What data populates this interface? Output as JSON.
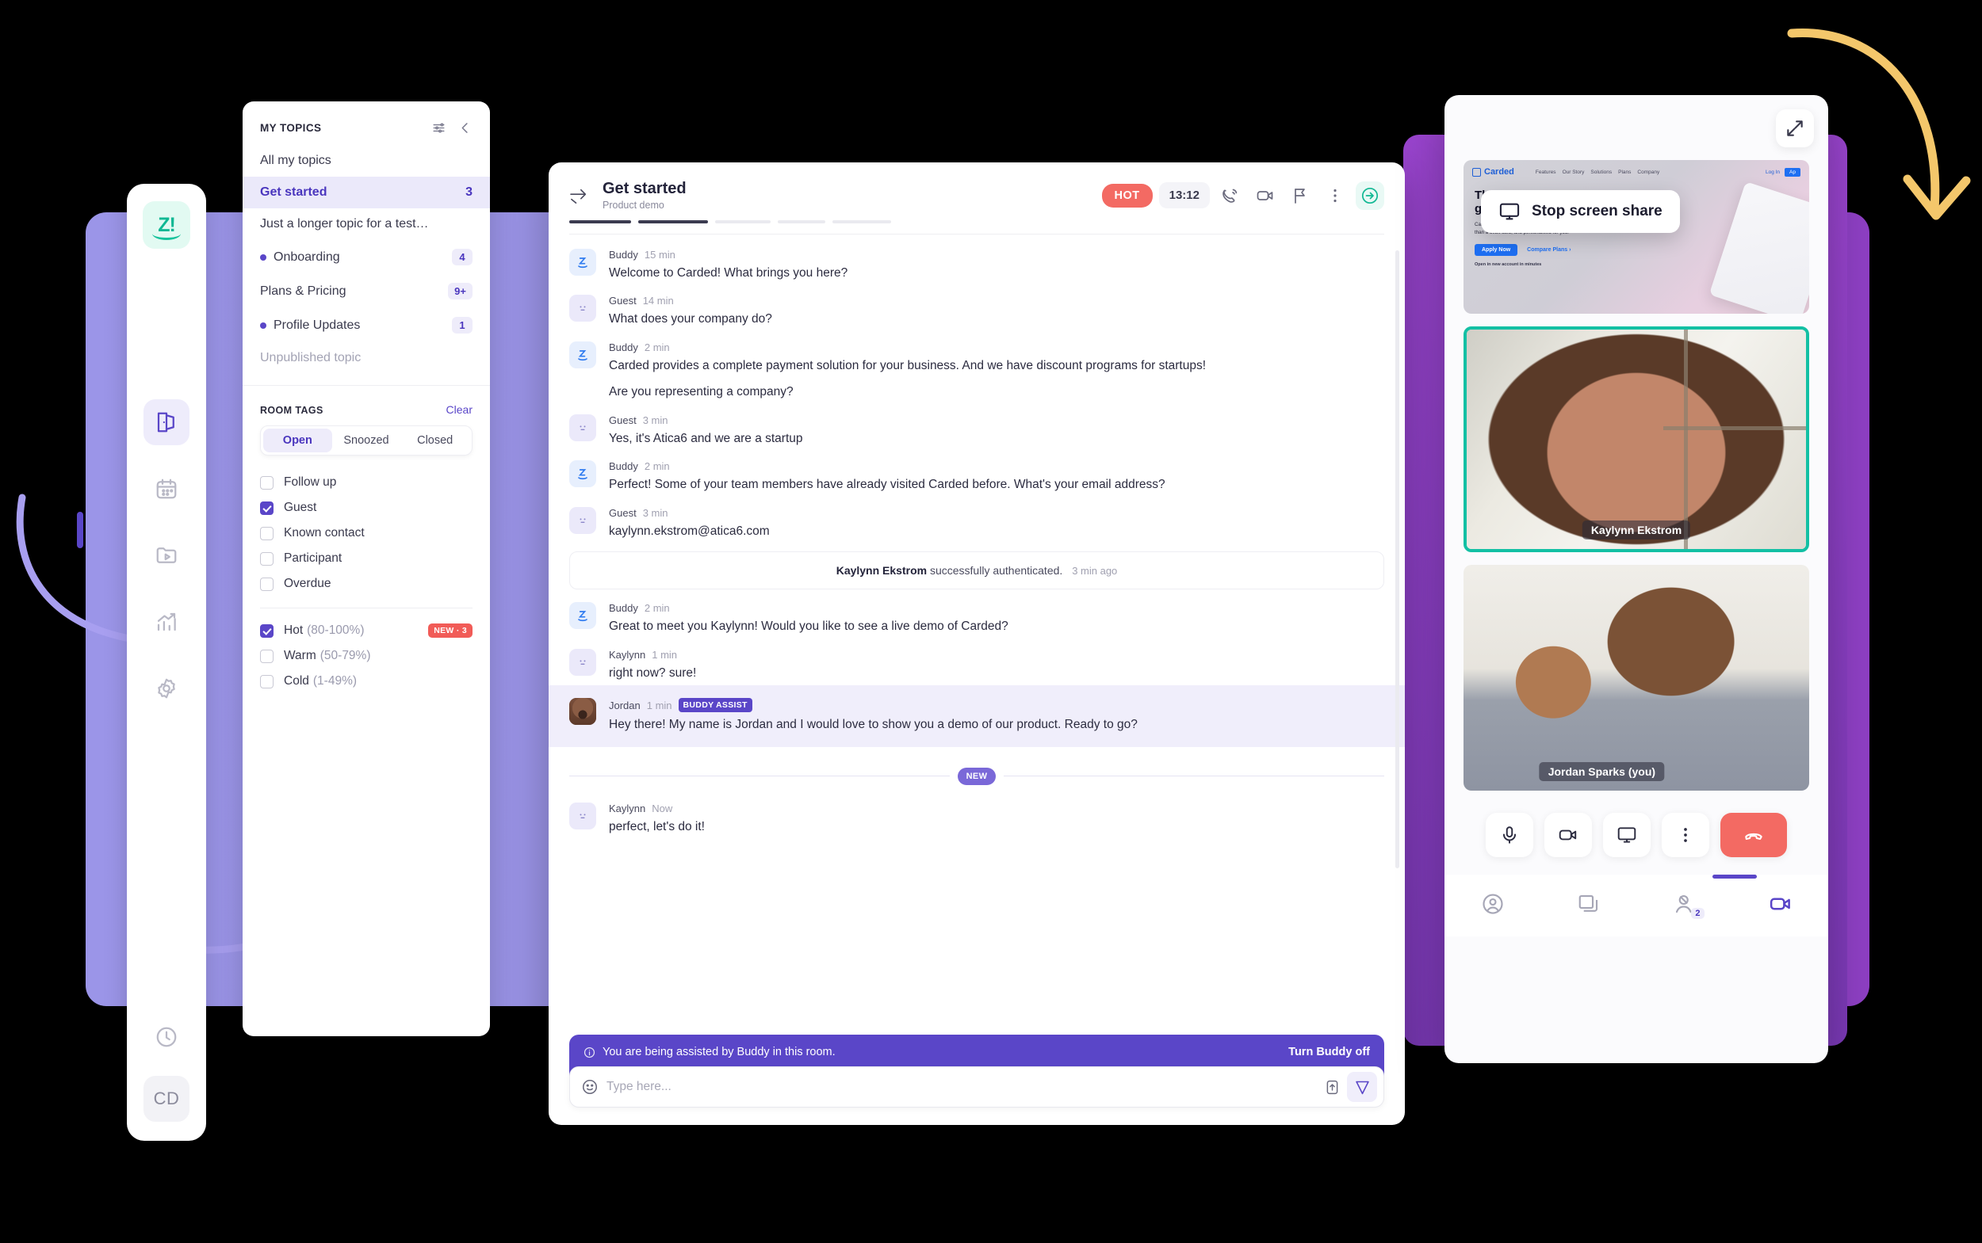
{
  "app": {
    "logo_text": "Z!",
    "user_initials": "CD"
  },
  "rail": {
    "items": [
      {
        "name": "rooms",
        "icon": "door-icon",
        "active": true
      },
      {
        "name": "calendar",
        "icon": "calendar-icon",
        "active": false
      },
      {
        "name": "library",
        "icon": "folder-play-icon",
        "active": false
      },
      {
        "name": "analytics",
        "icon": "bar-chart-icon",
        "active": false
      },
      {
        "name": "settings",
        "icon": "gear-icon",
        "active": false
      },
      {
        "name": "history",
        "icon": "clock-icon",
        "active": false
      }
    ]
  },
  "topics": {
    "header_title": "MY TOPICS",
    "filter_icon": "sliders-icon",
    "collapse_icon": "chevron-left-icon",
    "items": [
      {
        "label": "All my topics",
        "count": "",
        "dot": false,
        "selected": false,
        "muted": false
      },
      {
        "label": "Get started",
        "count": "3",
        "dot": false,
        "selected": true,
        "muted": false
      },
      {
        "label": "Just a longer topic for a test…",
        "count": "",
        "dot": false,
        "selected": false,
        "muted": false
      },
      {
        "label": "Onboarding",
        "count": "4",
        "dot": true,
        "selected": false,
        "muted": false
      },
      {
        "label": "Plans & Pricing",
        "count": "9+",
        "dot": false,
        "selected": false,
        "muted": false
      },
      {
        "label": "Profile Updates",
        "count": "1",
        "dot": true,
        "selected": false,
        "muted": false
      },
      {
        "label": "Unpublished topic",
        "count": "",
        "dot": false,
        "selected": false,
        "muted": true
      }
    ],
    "tags_title": "ROOM TAGS",
    "clear_label": "Clear",
    "segments": [
      {
        "label": "Open",
        "on": true
      },
      {
        "label": "Snoozed",
        "on": false
      },
      {
        "label": "Closed",
        "on": false
      }
    ],
    "checks": [
      {
        "label": "Follow up",
        "range": "",
        "checked": false,
        "badge": ""
      },
      {
        "label": "Guest",
        "range": "",
        "checked": true,
        "badge": ""
      },
      {
        "label": "Known contact",
        "range": "",
        "checked": false,
        "badge": ""
      },
      {
        "label": "Participant",
        "range": "",
        "checked": false,
        "badge": ""
      },
      {
        "label": "Overdue",
        "range": "",
        "checked": false,
        "badge": ""
      }
    ],
    "scores": [
      {
        "label": "Hot",
        "range": "(80-100%)",
        "checked": true,
        "badge": "NEW · 3"
      },
      {
        "label": "Warm",
        "range": "(50-79%)",
        "checked": false,
        "badge": ""
      },
      {
        "label": "Cold",
        "range": "(1-49%)",
        "checked": false,
        "badge": ""
      }
    ]
  },
  "chat": {
    "back_icon": "arrow-right-line-icon",
    "title": "Get started",
    "subtitle": "Product demo",
    "status_badge": "HOT",
    "timer": "13:12",
    "actions": [
      {
        "name": "call-icon"
      },
      {
        "name": "video-icon"
      },
      {
        "name": "flag-icon"
      },
      {
        "name": "more-vertical-icon"
      },
      {
        "name": "transfer-icon"
      }
    ],
    "progress": [
      true,
      true,
      false,
      false,
      false
    ],
    "messages": [
      {
        "kind": "msg",
        "author": "Buddy",
        "time": "15 min",
        "avatar": "buddy",
        "tag": "",
        "lines": [
          "Welcome to Carded! What brings you here?"
        ]
      },
      {
        "kind": "msg",
        "author": "Guest",
        "time": "14 min",
        "avatar": "guest",
        "tag": "",
        "lines": [
          "What does your company do?"
        ]
      },
      {
        "kind": "msg",
        "author": "Buddy",
        "time": "2 min",
        "avatar": "buddy",
        "tag": "",
        "lines": [
          "Carded provides a complete payment solution for your business. And we have discount programs for startups!",
          "Are you representing a company?"
        ]
      },
      {
        "kind": "msg",
        "author": "Guest",
        "time": "3 min",
        "avatar": "guest",
        "tag": "",
        "lines": [
          "Yes, it's Atica6 and we are a startup"
        ]
      },
      {
        "kind": "msg",
        "author": "Buddy",
        "time": "2 min",
        "avatar": "buddy",
        "tag": "",
        "lines": [
          "Perfect! Some of your team members have already visited Carded before. What's your email address?"
        ]
      },
      {
        "kind": "msg",
        "author": "Guest",
        "time": "3 min",
        "avatar": "guest",
        "tag": "",
        "lines": [
          "kaylynn.ekstrom@atica6.com"
        ]
      },
      {
        "kind": "system",
        "bold": "Kaylynn Ekstrom",
        "rest": "successfully authenticated.",
        "ago": "3 min ago"
      },
      {
        "kind": "msg",
        "author": "Buddy",
        "time": "2 min",
        "avatar": "buddy",
        "tag": "",
        "lines": [
          "Great to meet you Kaylynn! Would you like to see a live demo of Carded?"
        ]
      },
      {
        "kind": "msg",
        "author": "Kaylynn",
        "time": "1 min",
        "avatar": "guest",
        "tag": "",
        "lines": [
          "right now? sure!"
        ]
      },
      {
        "kind": "msg",
        "author": "Jordan",
        "time": "1 min",
        "avatar": "photo",
        "tag": "BUDDY ASSIST",
        "highlight": true,
        "lines": [
          "Hey there! My name is Jordan and I would love to show you a demo of our product. Ready to go?"
        ]
      },
      {
        "kind": "divider",
        "label": "NEW"
      },
      {
        "kind": "msg",
        "author": "Kaylynn",
        "time": "Now",
        "avatar": "guest",
        "tag": "",
        "lines": [
          "perfect, let's do it!"
        ]
      }
    ],
    "buddy_bar": {
      "info_icon": "info-icon",
      "text": "You are being assisted by Buddy in this room.",
      "toggle_label": "Turn Buddy off"
    },
    "composer": {
      "emoji_icon": "emoji-icon",
      "placeholder": "Type here...",
      "value": "",
      "attach_icon": "upload-icon",
      "send_icon": "send-icon"
    }
  },
  "call": {
    "expand_icon": "expand-icon",
    "screen_share": {
      "stop_label": "Stop screen share",
      "monitor_icon": "monitor-icon",
      "site": {
        "brand": "Carded",
        "nav": [
          "Features",
          "Our Story",
          "Solutions",
          "Plans",
          "Company"
        ],
        "login": "Log In",
        "apply_short": "Ap",
        "headline_line1": "The card that",
        "headline_line2": "gives you",
        "body": "Carded is a new kind of card, more than just a checking account, more than a debit card, and personalised for you.",
        "cta_primary": "Apply Now",
        "cta_secondary": "Compare Plans ›",
        "note": "Open in new account in minutes"
      }
    },
    "tiles": [
      {
        "name": "Kaylynn Ekstrom",
        "active": true,
        "bg": "kaylynn"
      },
      {
        "name": "Jordan Sparks (you)",
        "active": false,
        "bg": "jordan"
      }
    ],
    "controls": [
      {
        "name": "mic-icon",
        "style": "plain"
      },
      {
        "name": "video-icon",
        "style": "plain"
      },
      {
        "name": "screen-share-icon",
        "style": "plain"
      },
      {
        "name": "more-vertical-icon",
        "style": "plain"
      },
      {
        "name": "hangup-icon",
        "style": "hangup"
      }
    ],
    "tabs": [
      {
        "name": "profile-icon",
        "count": "",
        "on": false
      },
      {
        "name": "cards-icon",
        "count": "",
        "on": false
      },
      {
        "name": "participants-icon",
        "count": "2",
        "on": false
      },
      {
        "name": "video-icon",
        "count": "",
        "on": true
      }
    ]
  }
}
